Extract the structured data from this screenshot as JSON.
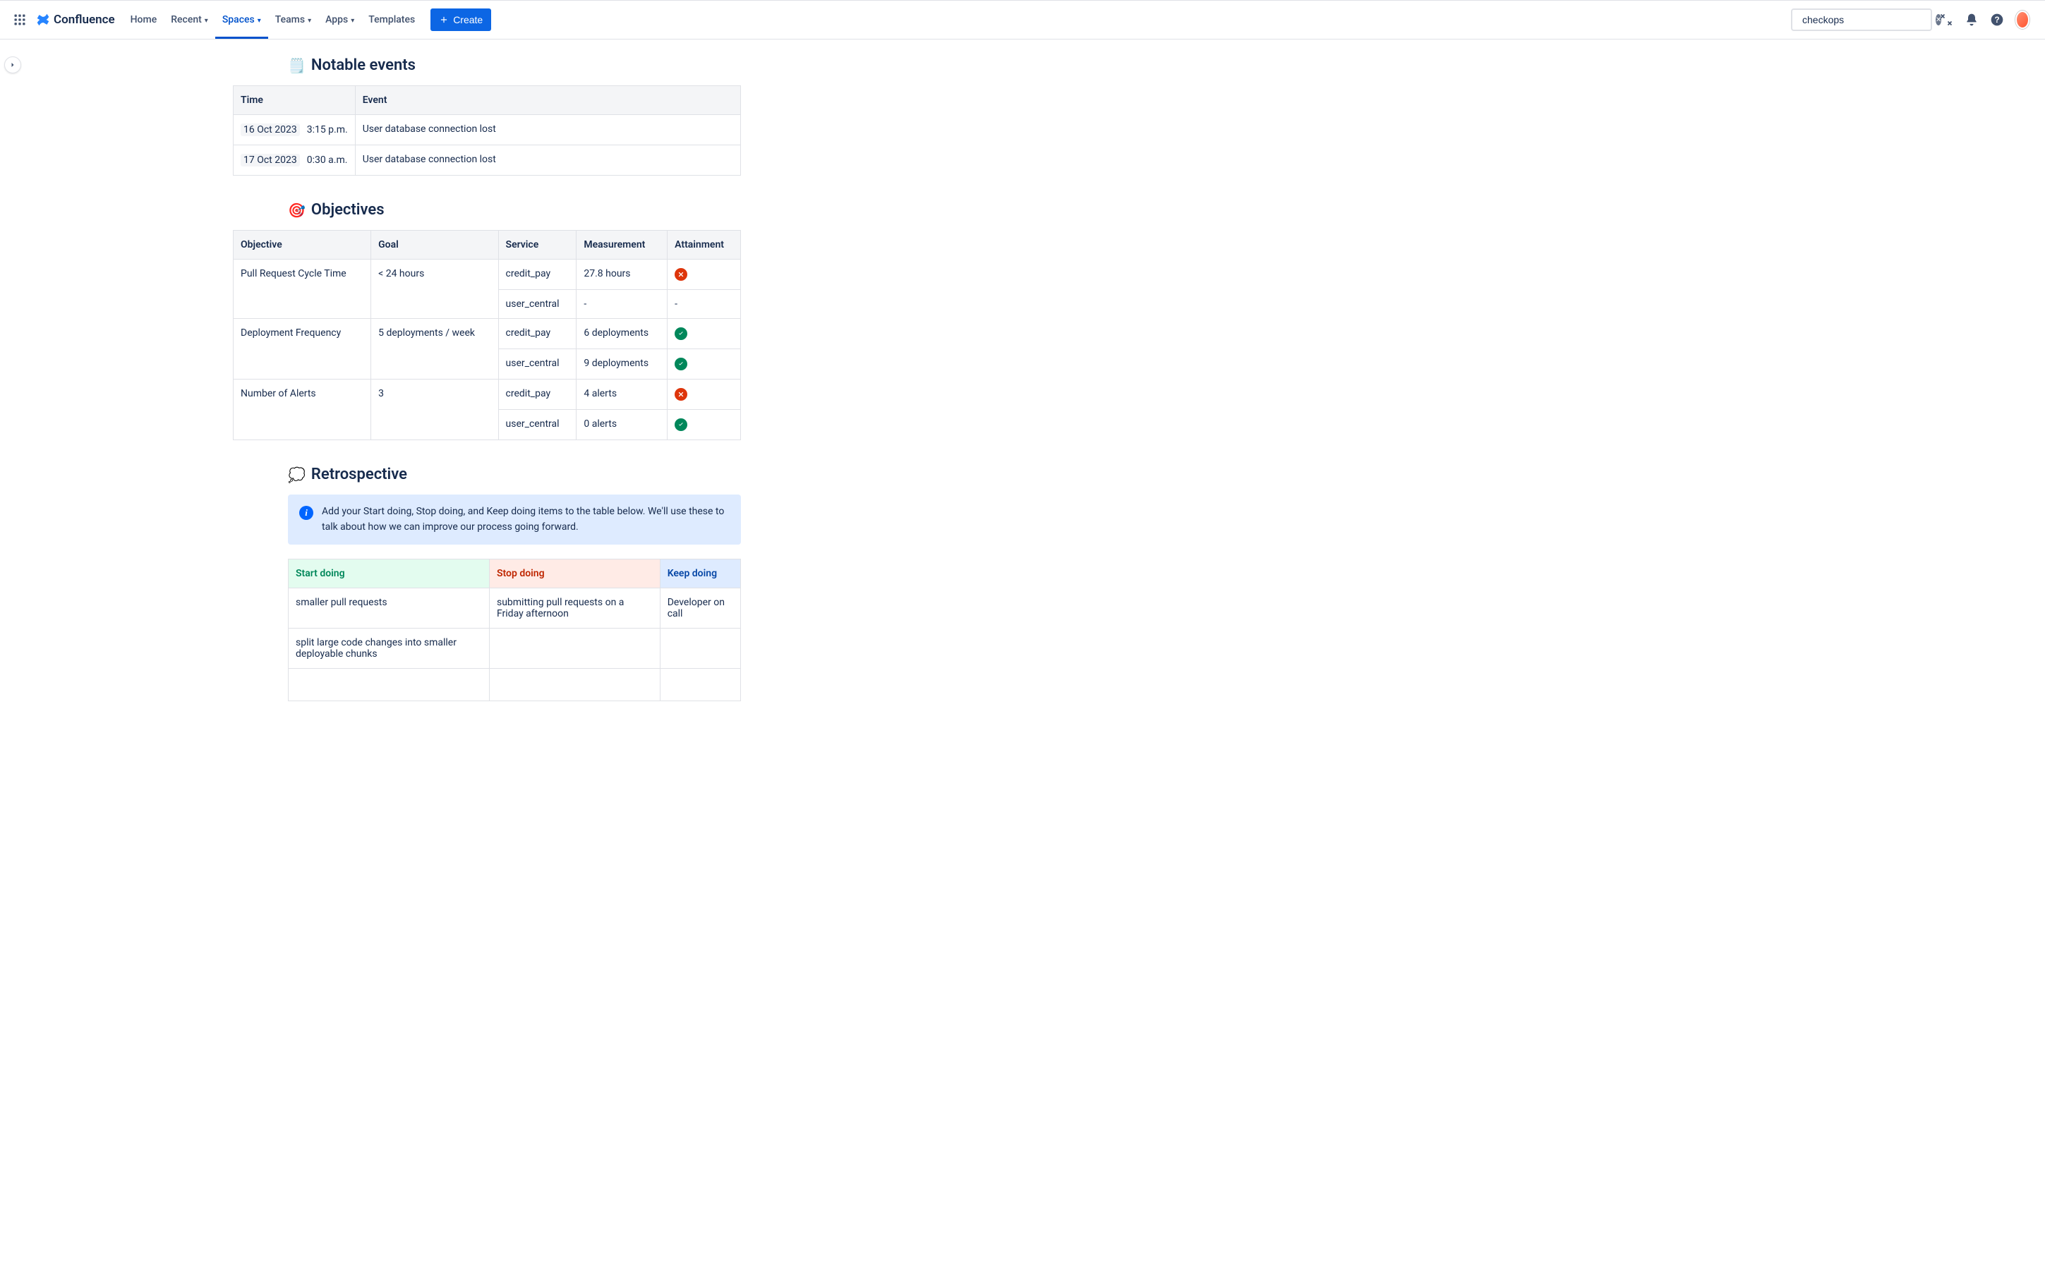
{
  "nav": {
    "product": "Confluence",
    "items": [
      {
        "label": "Home",
        "chevron": false,
        "active": false
      },
      {
        "label": "Recent",
        "chevron": true,
        "active": false
      },
      {
        "label": "Spaces",
        "chevron": true,
        "active": true
      },
      {
        "label": "Teams",
        "chevron": true,
        "active": false
      },
      {
        "label": "Apps",
        "chevron": true,
        "active": false
      },
      {
        "label": "Templates",
        "chevron": false,
        "active": false
      }
    ],
    "create_label": "Create"
  },
  "search": {
    "value": "checkops"
  },
  "notable_events": {
    "title": "Notable events",
    "emoji": "🗒️",
    "headers": [
      "Time",
      "Event"
    ],
    "rows": [
      {
        "date": "16 Oct 2023",
        "time": "3:15 p.m.",
        "event": "User database connection lost"
      },
      {
        "date": "17 Oct 2023",
        "time": "0:30 a.m.",
        "event": "User database connection lost"
      }
    ]
  },
  "objectives": {
    "title": "Objectives",
    "emoji": "🎯",
    "headers": [
      "Objective",
      "Goal",
      "Service",
      "Measurement",
      "Attainment"
    ],
    "rows": [
      {
        "objective": "Pull Request Cycle Time",
        "goal": "< 24 hours",
        "services": [
          {
            "service": "credit_pay",
            "measurement": "27.8 hours",
            "attainment": "fail"
          },
          {
            "service": "user_central",
            "measurement": "-",
            "attainment": "none"
          }
        ]
      },
      {
        "objective": "Deployment Frequency",
        "goal": "5 deployments / week",
        "services": [
          {
            "service": "credit_pay",
            "measurement": "6 deployments",
            "attainment": "pass"
          },
          {
            "service": "user_central",
            "measurement": "9 deployments",
            "attainment": "pass"
          }
        ]
      },
      {
        "objective": "Number of Alerts",
        "goal": "3",
        "services": [
          {
            "service": "credit_pay",
            "measurement": "4 alerts",
            "attainment": "fail"
          },
          {
            "service": "user_central",
            "measurement": "0 alerts",
            "attainment": "pass"
          }
        ]
      }
    ]
  },
  "retrospective": {
    "title": "Retrospective",
    "emoji": "💭",
    "info": "Add your Start doing, Stop doing, and Keep doing items to the table below. We'll use these to talk about how we can improve our process going forward.",
    "headers": {
      "start": "Start doing",
      "stop": "Stop doing",
      "keep": "Keep doing"
    },
    "rows": [
      {
        "start": "smaller pull requests",
        "stop": "submitting pull requests on a Friday afternoon",
        "keep": "Developer on call"
      },
      {
        "start": "split large code changes into smaller deployable chunks",
        "stop": "",
        "keep": ""
      },
      {
        "start": "",
        "stop": "",
        "keep": ""
      }
    ]
  }
}
